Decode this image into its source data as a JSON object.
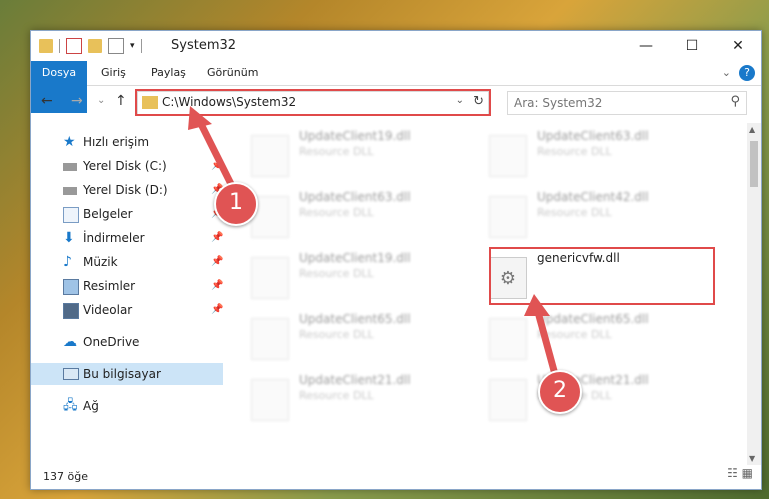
{
  "window": {
    "title": "System32",
    "min_label": "—",
    "max_label": "☐",
    "close_label": "✕"
  },
  "ribbon": {
    "tabs": [
      "Dosya",
      "Giriş",
      "Paylaş",
      "Görünüm"
    ],
    "help_label": "?",
    "expand_label": "⌄"
  },
  "nav": {
    "back": "←",
    "forward": "→",
    "recent": "⌄",
    "up": "↑",
    "address_path": "C:\\Windows\\System32",
    "address_dropdown": "⌄",
    "refresh": "↻",
    "search_placeholder": "Ara: System32",
    "search_icon": "⚲"
  },
  "sidebar": {
    "items": [
      {
        "label": "Hızlı erişim",
        "icon": "star-icon",
        "pinned": false
      },
      {
        "label": "Yerel Disk (C:)",
        "icon": "drive-icon",
        "pinned": true
      },
      {
        "label": "Yerel Disk (D:)",
        "icon": "drive-icon",
        "pinned": true
      },
      {
        "label": "Belgeler",
        "icon": "documents-icon",
        "pinned": true
      },
      {
        "label": "İndirmeler",
        "icon": "download-icon",
        "pinned": true
      },
      {
        "label": "Müzik",
        "icon": "music-icon",
        "pinned": true
      },
      {
        "label": "Resimler",
        "icon": "pictures-icon",
        "pinned": true
      },
      {
        "label": "Videolar",
        "icon": "videos-icon",
        "pinned": true
      },
      {
        "label": "OneDrive",
        "icon": "cloud-icon",
        "pinned": false
      },
      {
        "label": "Bu bilgisayar",
        "icon": "computer-icon",
        "pinned": false
      },
      {
        "label": "Ağ",
        "icon": "network-icon",
        "pinned": false
      }
    ],
    "pin_glyph": "📌"
  },
  "files": {
    "left_column": [
      {
        "name": "UpdateClient19.dll",
        "desc": "Resource DLL"
      },
      {
        "name": "UpdateClient63.dll",
        "desc": "Resource DLL"
      },
      {
        "name": "UpdateClient19.dll",
        "desc": "Resource DLL"
      },
      {
        "name": "UpdateClient65.dll",
        "desc": "Resource DLL"
      },
      {
        "name": "UpdateClient21.dll",
        "desc": "Resource DLL"
      }
    ],
    "right_column": [
      {
        "name": "UpdateClient63.dll",
        "desc": "Resource DLL"
      },
      {
        "name": "UpdateClient42.dll",
        "desc": "Resource DLL"
      },
      {
        "name": "genericvfw.dll",
        "desc": ""
      },
      {
        "name": "UpdateClient65.dll",
        "desc": "Resource DLL"
      },
      {
        "name": "UpdateClient21.dll",
        "desc": "Resource DLL"
      }
    ]
  },
  "status": {
    "item_count": "137 öğe",
    "view_icons": "☷ ▦"
  },
  "callouts": {
    "one": "1",
    "two": "2"
  },
  "colors": {
    "accent": "#1979ca",
    "highlight": "#e04a4a",
    "selected": "#cce4f7"
  }
}
